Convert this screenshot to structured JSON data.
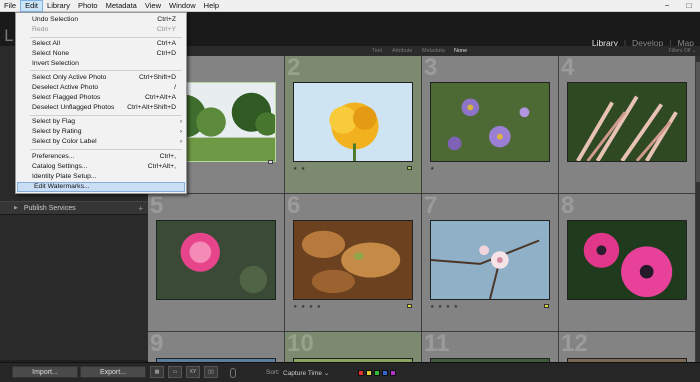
{
  "menubar": {
    "items": [
      "File",
      "Edit",
      "Library",
      "Photo",
      "Metadata",
      "View",
      "Window",
      "Help"
    ],
    "active_index": 1
  },
  "window_controls": {
    "minimize": "−",
    "maximize": "□"
  },
  "header": {
    "logo": "L",
    "modules": [
      "Library",
      "Develop",
      "Map"
    ],
    "active_module": "Library",
    "separator": "|"
  },
  "filter_bar": {
    "items": [
      "Text",
      "Attribute",
      "Metadata",
      "None"
    ],
    "active": "None",
    "filters_off": "Filters Off ⌄"
  },
  "left_panel": {
    "publish_services": "Publish Services",
    "plus": "+",
    "triangle": "▶"
  },
  "edit_menu": {
    "items": [
      {
        "label": "Undo Selection",
        "shortcut": "Ctrl+Z",
        "disabled": false
      },
      {
        "label": "Redo",
        "shortcut": "Ctrl+Y",
        "disabled": true
      },
      {
        "label": "Select All",
        "shortcut": "Ctrl+A",
        "disabled": false
      },
      {
        "label": "Select None",
        "shortcut": "Ctrl+D",
        "disabled": false
      },
      {
        "label": "Invert Selection",
        "shortcut": "",
        "disabled": false
      },
      {
        "label": "Select Only Active Photo",
        "shortcut": "Ctrl+Shift+D",
        "disabled": false
      },
      {
        "label": "Deselect Active Photo",
        "shortcut": "/",
        "disabled": false
      },
      {
        "label": "Select Flagged Photos",
        "shortcut": "Ctrl+Alt+A",
        "disabled": false
      },
      {
        "label": "Deselect Unflagged Photos",
        "shortcut": "Ctrl+Alt+Shift+D",
        "disabled": false
      },
      {
        "label": "Select by Flag",
        "shortcut": "",
        "submenu": true
      },
      {
        "label": "Select by Rating",
        "shortcut": "",
        "submenu": true
      },
      {
        "label": "Select by Color Label",
        "shortcut": "",
        "submenu": true
      },
      {
        "label": "Preferences...",
        "shortcut": "Ctrl+,",
        "disabled": false
      },
      {
        "label": "Catalog Settings...",
        "shortcut": "Ctrl+Alt+,",
        "disabled": false
      },
      {
        "label": "Identity Plate Setup...",
        "shortcut": "",
        "disabled": false
      },
      {
        "label": "Edit Watermarks...",
        "shortcut": "",
        "disabled": false,
        "highlight": true
      }
    ],
    "submenu_arrow": "›"
  },
  "grid": {
    "cells": [
      {
        "number": "1",
        "subject": "park-trees",
        "stars": "",
        "selected": true
      },
      {
        "number": "2",
        "subject": "yellow-rose",
        "stars": "★ ★",
        "selected": false
      },
      {
        "number": "3",
        "subject": "purple-asters",
        "stars": "★",
        "selected": false
      },
      {
        "number": "4",
        "subject": "pink-grass",
        "stars": "",
        "selected": false
      },
      {
        "number": "5",
        "subject": "pink-mimosa-flower",
        "stars": "",
        "selected": false
      },
      {
        "number": "6",
        "subject": "autumn-leaves",
        "stars": "★ ★ ★ ★",
        "selected": false
      },
      {
        "number": "7",
        "subject": "blossom-branch",
        "stars": "★ ★ ★ ★",
        "selected": false
      },
      {
        "number": "8",
        "subject": "pink-poppy",
        "stars": "",
        "selected": false
      },
      {
        "number": "9",
        "subject": "",
        "stars": "",
        "selected": false
      },
      {
        "number": "10",
        "subject": "",
        "stars": "",
        "selected": false
      },
      {
        "number": "11",
        "subject": "",
        "stars": "",
        "selected": false
      },
      {
        "number": "12",
        "subject": "",
        "stars": "",
        "selected": false
      }
    ]
  },
  "bottom_bar": {
    "import": "Import...",
    "export": "Export...",
    "sort_label": "Sort:",
    "sort_value": "Capture Time ⌄",
    "view_icons": [
      "▦",
      "▭",
      "XY",
      "▯▯"
    ],
    "color_labels": [
      "#d33",
      "#dc3",
      "#3b3",
      "#36c",
      "#a3c"
    ]
  },
  "colors": {
    "menu_highlight": "#c9def5",
    "grid_bg": "#5e5e5e",
    "active_cell_bg": "#7c8b6f"
  }
}
